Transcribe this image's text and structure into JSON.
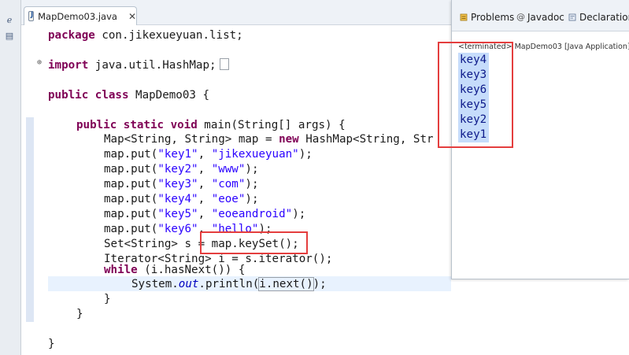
{
  "editor": {
    "tab_title": "MapDemo03.java",
    "tab_close": "✕"
  },
  "code": {
    "l1_kw": "package",
    "l1_rest": " con.jikexueyuan.list;",
    "l3_kw": "import",
    "l3_rest": " java.util.HashMap;",
    "l3_fold": "⊕",
    "l5_kw": "public class",
    "l5_rest": " MapDemo03 {",
    "l7_kw": "public static void",
    "l7_rest": " main(String[] args) {",
    "l8_a": "Map<String, String> map = ",
    "l8_kw": "new",
    "l8_b": " HashMap<String, Str",
    "puts": [
      {
        "k": "\"key1\"",
        "v": "\"jikexueyuan\""
      },
      {
        "k": "\"key2\"",
        "v": "\"www\""
      },
      {
        "k": "\"key3\"",
        "v": "\"com\""
      },
      {
        "k": "\"key4\"",
        "v": "\"eoe\""
      },
      {
        "k": "\"key5\"",
        "v": "\"eoeandroid\""
      },
      {
        "k": "\"key6\"",
        "v": "\"hello\""
      }
    ],
    "put_prefix": "map.put(",
    "put_sep": ", ",
    "put_suffix": ");",
    "l15_a": "Set<String> s ",
    "l15_b": "= map.keySet();",
    "l16": "Iterator<String> i = s.iterator();",
    "l17_kw": "while",
    "l17_rest": " (i.hasNext()) {",
    "l18_a": "System.",
    "l18_fld": "out",
    "l18_b": ".println(",
    "l18_c": "i.next()",
    "l18_d": ");",
    "close_brace": "}"
  },
  "views": {
    "problems": "Problems",
    "javadoc": "Javadoc",
    "declaration": "Declaration"
  },
  "console": {
    "header": "<terminated> MapDemo03 [Java Application]",
    "lines": [
      "key4",
      "key3",
      "key6",
      "key5",
      "key2",
      "key1"
    ]
  },
  "colors": {
    "annotation": "#e43e3e",
    "keyword": "#7f0055",
    "string": "#2a00ff",
    "selection": "#c6dcfb"
  }
}
